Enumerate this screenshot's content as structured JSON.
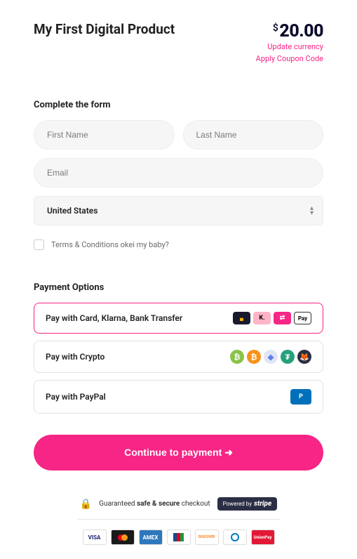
{
  "product": {
    "title": "My First Digital Product"
  },
  "price": {
    "currency": "$",
    "amount": "20.00"
  },
  "links": {
    "update_currency": "Update currency",
    "apply_coupon": "Apply Coupon Code"
  },
  "form": {
    "heading": "Complete the form",
    "first_name_ph": "First Name",
    "last_name_ph": "Last Name",
    "email_ph": "Email",
    "country_value": "United States",
    "terms_label": "Terms & Conditions okei my baby?"
  },
  "payment": {
    "heading": "Payment Options",
    "options": [
      {
        "label": "Pay with Card, Klarna, Bank Transfer",
        "selected": true
      },
      {
        "label": "Pay with Crypto",
        "selected": false
      },
      {
        "label": "Pay with PayPal",
        "selected": false
      }
    ]
  },
  "cta": {
    "label": "Continue to payment ➜"
  },
  "footer": {
    "guarantee_prefix": "Guaranteed ",
    "guarantee_strong": "safe & secure",
    "guarantee_suffix": " checkout",
    "powered_by": "Powered by",
    "stripe": "stripe",
    "card_brands": [
      "VISA",
      "MC",
      "AMEX",
      "JCB",
      "DISCOVER",
      "DINERS",
      "UNIONPAY"
    ]
  }
}
